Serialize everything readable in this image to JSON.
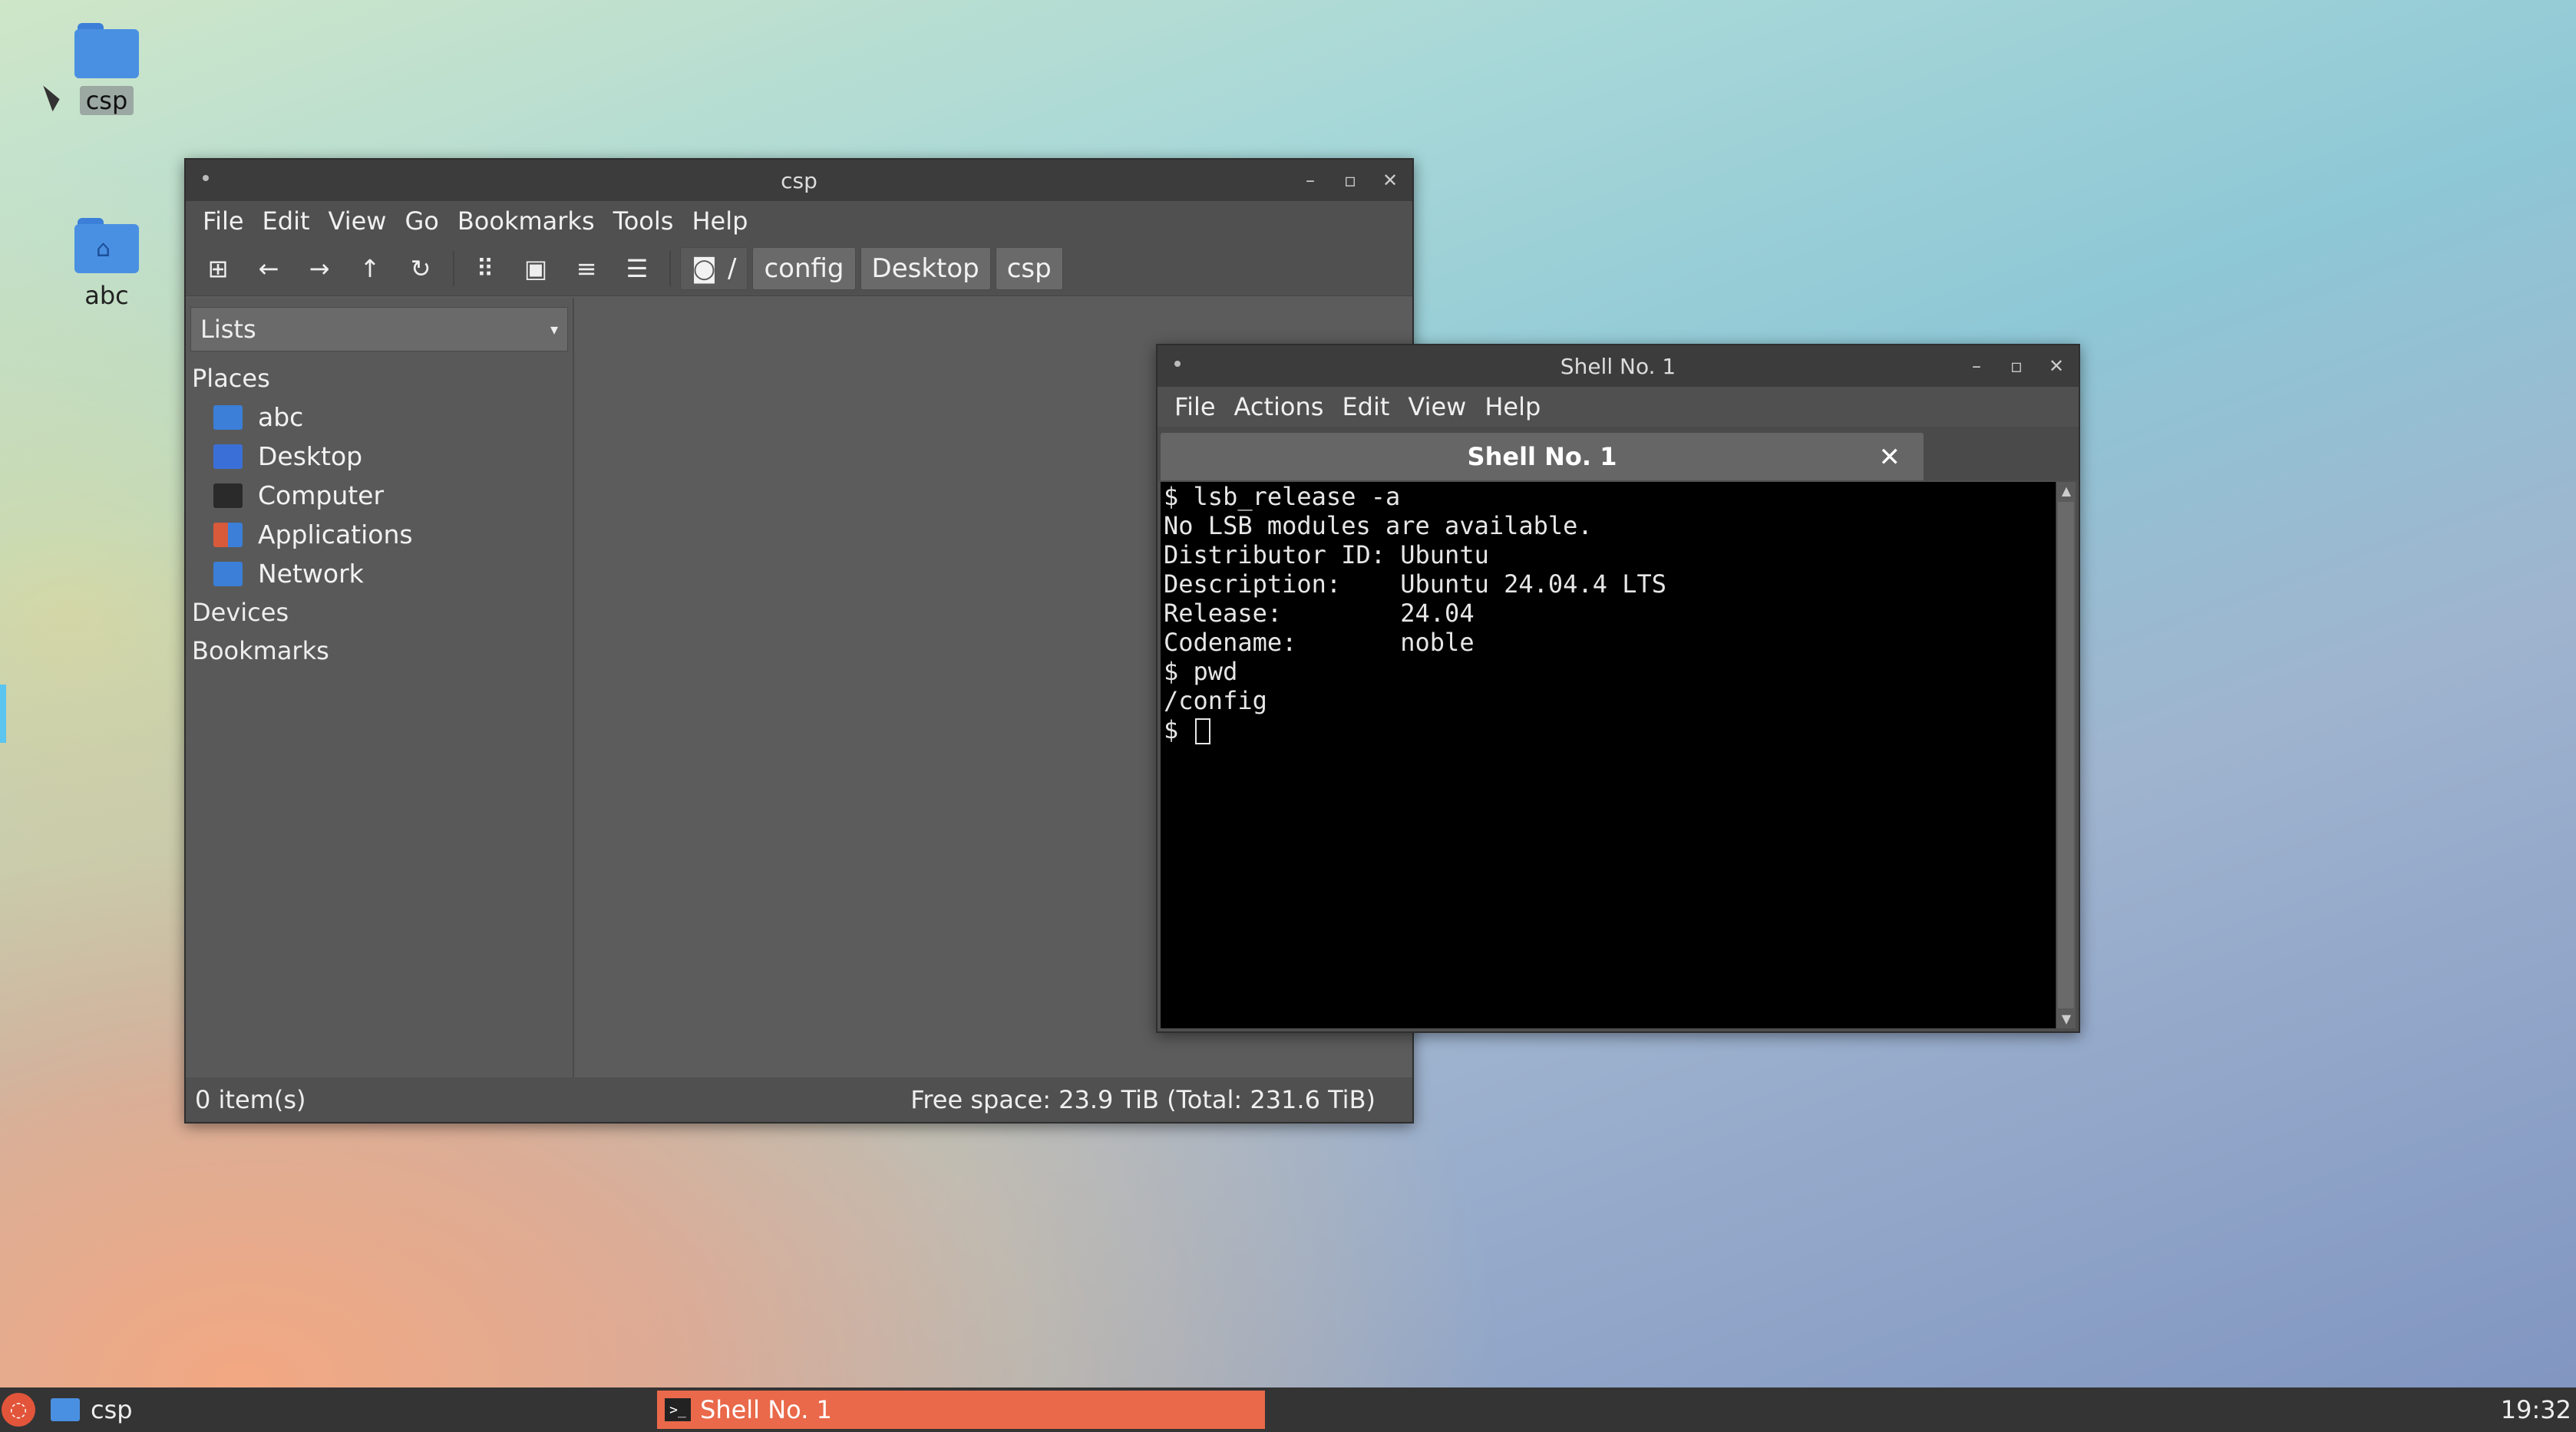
{
  "desktop": {
    "icons": [
      {
        "label": "csp",
        "icon": "folder-icon"
      },
      {
        "label": "abc",
        "icon": "home-folder-icon"
      }
    ]
  },
  "file_manager": {
    "title": "csp",
    "menu": [
      "File",
      "Edit",
      "View",
      "Go",
      "Bookmarks",
      "Tools",
      "Help"
    ],
    "toolbar_icons": [
      "new-tab-icon",
      "back-icon",
      "forward-icon",
      "up-icon",
      "reload-icon",
      "icon-view-icon",
      "thumbnail-view-icon",
      "compact-view-icon",
      "detailed-list-icon"
    ],
    "path_root": "/",
    "breadcrumbs": [
      "config",
      "Desktop",
      "csp"
    ],
    "sidebar_mode": "Lists",
    "places_header": "Places",
    "places": [
      {
        "label": "abc",
        "color": "#3b7fd8"
      },
      {
        "label": "Desktop",
        "color": "#3b6fd8"
      },
      {
        "label": "Computer",
        "color": "#2a2a2a"
      },
      {
        "label": "Applications",
        "color": "#d85a3b"
      },
      {
        "label": "Network",
        "color": "#3b7fd8"
      }
    ],
    "devices_header": "Devices",
    "bookmarks_header": "Bookmarks",
    "status_items": "0 item(s)",
    "status_space": "Free space: 23.9 TiB (Total: 231.6 TiB)"
  },
  "terminal": {
    "title": "Shell No. 1",
    "menu": [
      "File",
      "Actions",
      "Edit",
      "View",
      "Help"
    ],
    "tab_label": "Shell No. 1",
    "lines": [
      "$ lsb_release -a",
      "No LSB modules are available.",
      "Distributor ID: Ubuntu",
      "Description:    Ubuntu 24.04.4 LTS",
      "Release:        24.04",
      "Codename:       noble",
      "$ pwd",
      "/config",
      "$ "
    ]
  },
  "taskbar": {
    "folder_task": "csp",
    "shell_task": "Shell No. 1",
    "clock": "19:32"
  }
}
